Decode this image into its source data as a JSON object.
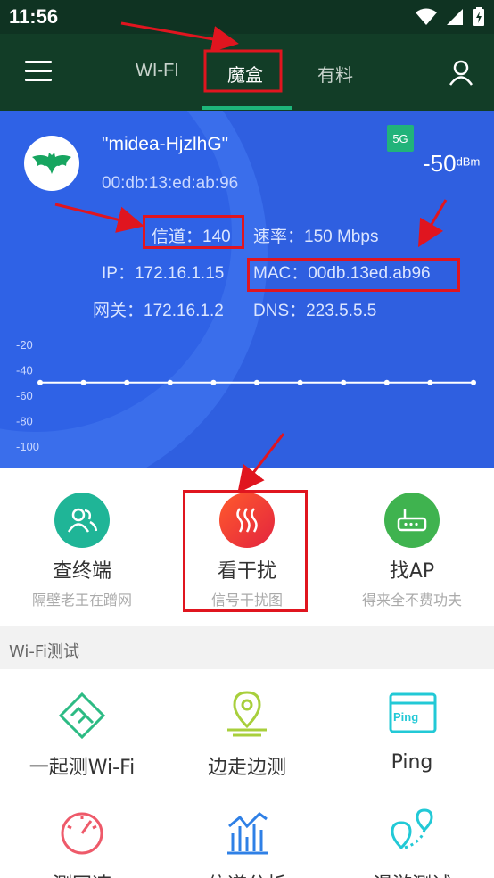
{
  "status_bar": {
    "time": "11:56"
  },
  "header": {
    "tabs": [
      {
        "label": "WI-FI"
      },
      {
        "label": "魔盒"
      },
      {
        "label": "有料"
      }
    ],
    "active_tab_index": 1
  },
  "network": {
    "ssid": "\"midea-HjzlhG\"",
    "bssid": "00:db:13:ed:ab:96",
    "band_badge": "5G",
    "signal_value": "-50",
    "signal_unit": "dBm",
    "channel": "信道：140",
    "rate": "速率：150 Mbps",
    "ip": "IP：172.16.1.15",
    "mac": "MAC：00db.13ed.ab96",
    "gateway": "网关：172.16.1.2",
    "dns": "DNS：223.5.5.5"
  },
  "signal_chart": {
    "y_ticks": [
      "-20",
      "-40",
      "-60",
      "-80",
      "-100"
    ]
  },
  "chart_data": {
    "type": "line",
    "ylim": [
      -100,
      -20
    ],
    "yticks": [
      -20,
      -40,
      -60,
      -80,
      -100
    ],
    "series": [
      {
        "values": [
          -50,
          -50,
          -50,
          -50,
          -50,
          -50,
          -50,
          -50,
          -50,
          -50,
          -50
        ]
      }
    ]
  },
  "tools": [
    {
      "title": "查终端",
      "subtitle": "隔壁老王在蹭网",
      "icon": "users-icon",
      "color": "#1fb597"
    },
    {
      "title": "看干扰",
      "subtitle": "信号干扰图",
      "icon": "heat-waves-icon",
      "color": "#f2493b"
    },
    {
      "title": "找AP",
      "subtitle": "得来全不费功夫",
      "icon": "router-icon",
      "color": "#3fb34f"
    }
  ],
  "wifi_test": {
    "section_title": "Wi-Fi测试",
    "items": [
      {
        "label": "一起测Wi-Fi",
        "icon": "handshake-icon",
        "color": "#2dbb84"
      },
      {
        "label": "边走边测",
        "icon": "location-pin-icon",
        "color": "#a8cf3c"
      },
      {
        "label": "Ping",
        "icon": "ping-window-icon",
        "color": "#22c9d6"
      },
      {
        "label": "测网速",
        "icon": "speedometer-icon",
        "color": "#ee5a6a"
      },
      {
        "label": "信道分析",
        "icon": "bar-chart-icon",
        "color": "#2f80e6"
      },
      {
        "label": "漫游测试",
        "icon": "roaming-pins-icon",
        "color": "#22c9d6"
      }
    ]
  }
}
